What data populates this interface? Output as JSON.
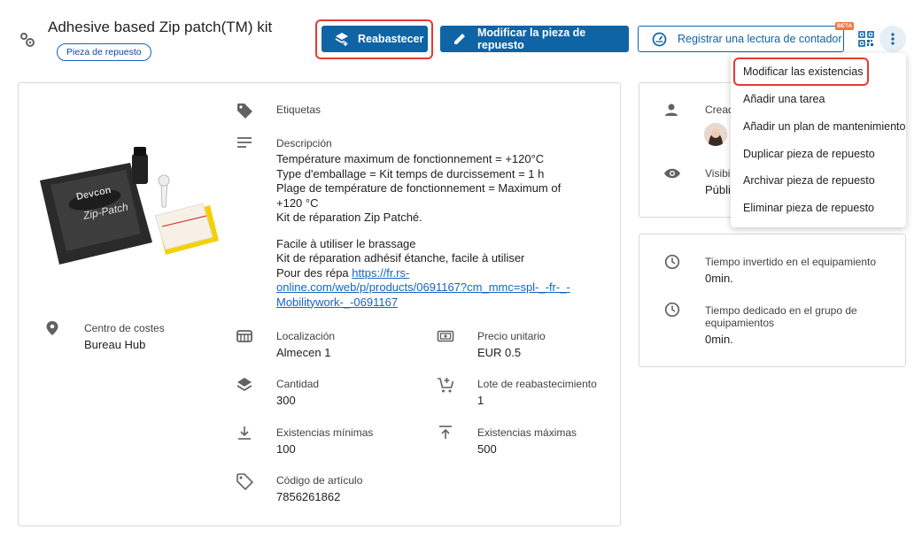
{
  "header": {
    "title": "Adhesive based Zip patch(TM) kit",
    "chip_label": "Pieza de repuesto",
    "restock_label": "Reabastecer",
    "edit_label": "Modificar la pieza de repuesto",
    "meter_label": "Registrar una lectura de contador",
    "beta_label": "BETA"
  },
  "details": {
    "tags_label": "Etiquetas",
    "description_label": "Descripción",
    "description_lines": [
      "Température maximum de fonctionnement = +120°C",
      "Type d'emballage = Kit temps de durcissement = 1 h",
      "Plage de température de fonctionnement = Maximum of",
      "+120 °C",
      "Kit de réparation Zip Patché."
    ],
    "description_lines2": [
      "Facile à utiliser le brassage",
      "Kit de réparation adhésif étanche, facile à utiliser"
    ],
    "link_prefix": "Pour des répa ",
    "link_line1": "https://fr.rs-",
    "link_line2": "online.com/web/p/products/0691167?cm_mmc=spl-_-fr-_-",
    "link_line3": "Mobilitywork-_-0691167",
    "cost_center_label": "Centro de costes",
    "cost_center_value": "Bureau Hub",
    "location_label": "Localización",
    "location_value": "Almecen 1",
    "unit_price_label": "Precio unitario",
    "unit_price_value": "EUR 0.5",
    "quantity_label": "Cantidad",
    "quantity_value": "300",
    "restock_batch_label": "Lote de reabastecimiento",
    "restock_batch_value": "1",
    "min_stock_label": "Existencias mínimas",
    "min_stock_value": "100",
    "max_stock_label": "Existencias máximas",
    "max_stock_value": "500",
    "article_code_label": "Código de artículo",
    "article_code_value": "7856261862"
  },
  "side": {
    "created_label": "Cread",
    "visibility_label": "Visibil",
    "visibility_value": "Públi",
    "time_equipment_label": "Tiempo invertido en el equipamiento",
    "time_equipment_value": "0min.",
    "time_group_label_1": "Tiempo dedicado en el grupo de",
    "time_group_label_2": "equipamientos",
    "time_group_value": "0min."
  },
  "menu": {
    "items": [
      "Modificar las existencias",
      "Añadir una tarea",
      "Añadir un plan de mantenimiento",
      "Duplicar pieza de repuesto",
      "Archivar pieza de repuesto",
      "Eliminar pieza de repuesto"
    ]
  },
  "product_image": {
    "pouch_text": "Devcon",
    "pouch_subtext": "Zip-Patch"
  },
  "colors": {
    "primary": "#0f64a6",
    "highlight": "#e53935",
    "beta": "#f4733a"
  }
}
